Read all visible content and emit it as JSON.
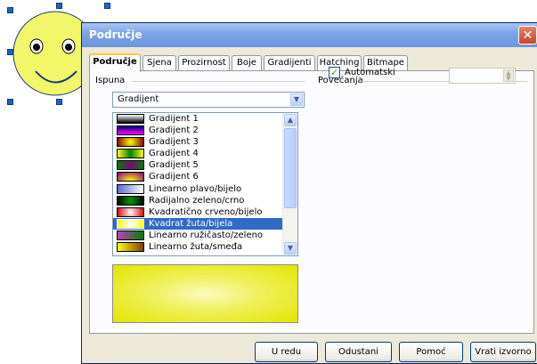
{
  "dialog": {
    "title": "Područje",
    "close_icon": "close-icon"
  },
  "tabs": [
    {
      "label": "Područje",
      "active": true
    },
    {
      "label": "Sjena"
    },
    {
      "label": "Prozirnost"
    },
    {
      "label": "Boje"
    },
    {
      "label": "Gradijenti"
    },
    {
      "label": "Hatching"
    },
    {
      "label": "Bitmape"
    }
  ],
  "fill": {
    "group_label": "Ispuna",
    "type_value": "Gradijent",
    "items": [
      {
        "label": "Gradijent 1"
      },
      {
        "label": "Gradijent 2"
      },
      {
        "label": "Gradijent 3"
      },
      {
        "label": "Gradijent 4"
      },
      {
        "label": "Gradijent 5"
      },
      {
        "label": "Gradijent 6"
      },
      {
        "label": "Linearno plavo/bijelo"
      },
      {
        "label": "Radijalno zeleno/crno"
      },
      {
        "label": "Kvadratično crveno/bijelo"
      },
      {
        "label": "Kvadrat žuta/bijela",
        "selected": true
      },
      {
        "label": "Linearno ružičasto/zeleno"
      },
      {
        "label": "Linearno žuta/smeđa"
      }
    ]
  },
  "increments": {
    "group_label": "Povećanja",
    "automatic_label": "Automatski",
    "automatic_checked": true,
    "steps_value": ""
  },
  "buttons": {
    "ok": "U redu",
    "cancel": "Odustani",
    "help": "Pomoć",
    "reset": "Vrati izvorno"
  },
  "colors": {
    "accent": "#316ac5",
    "titlebar": "#7fa5e6"
  }
}
